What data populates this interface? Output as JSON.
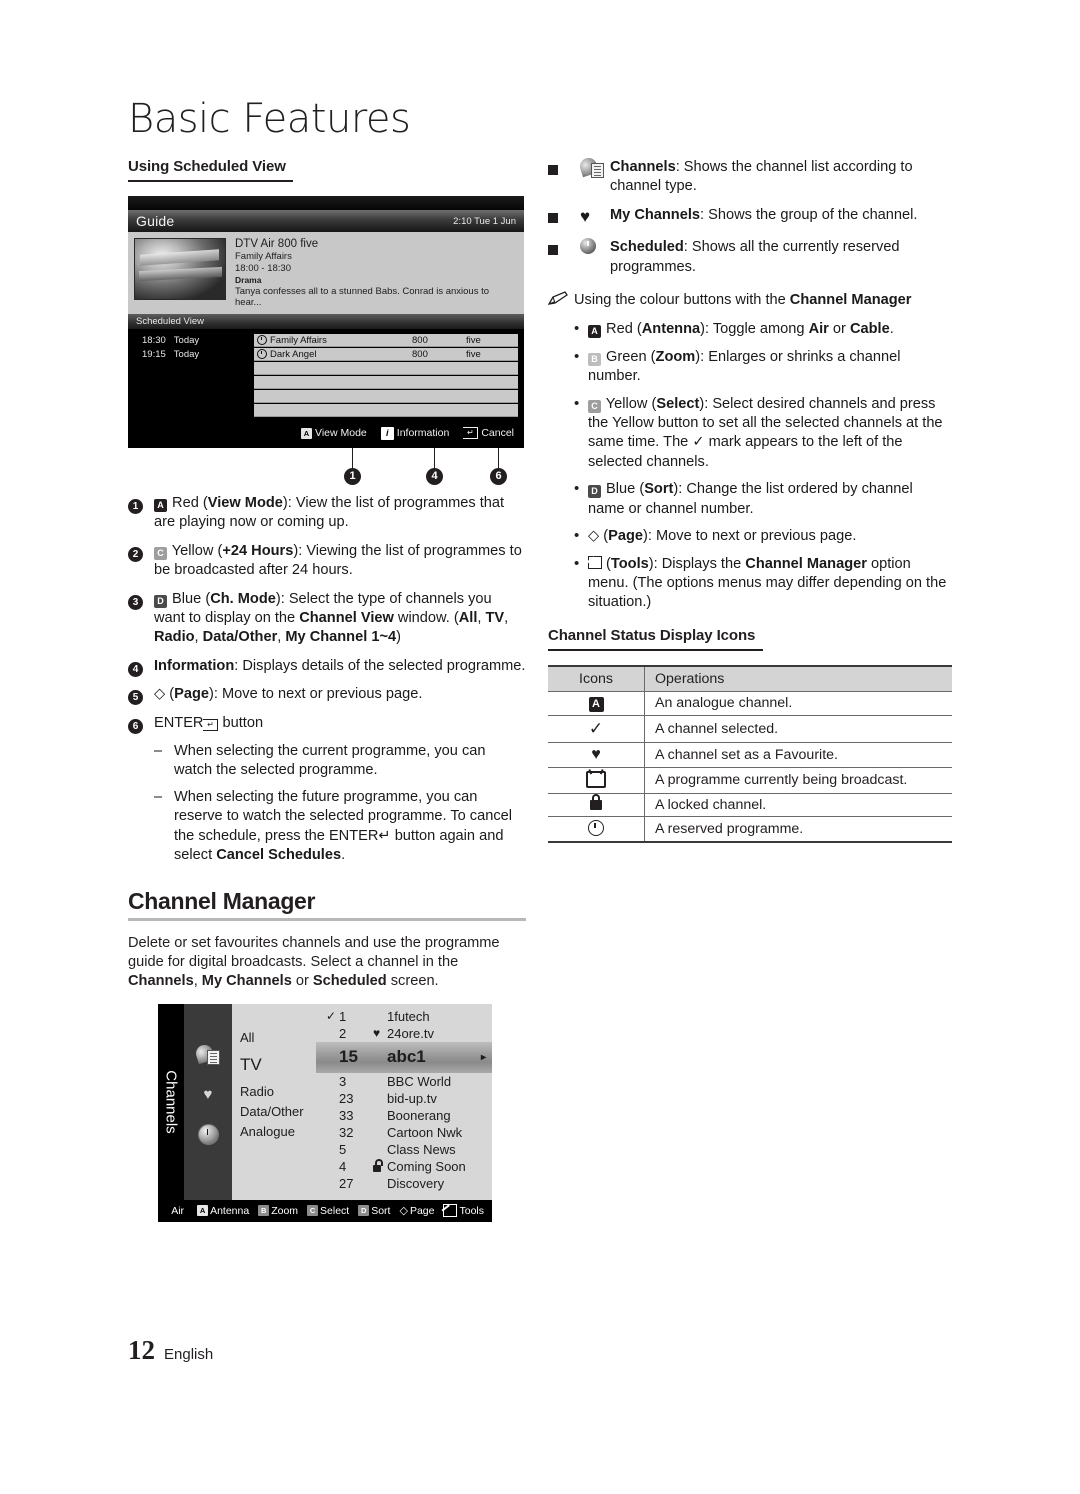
{
  "page": {
    "title": "Basic Features",
    "footer_page_number": "12",
    "footer_language": "English"
  },
  "left": {
    "subhead": "Using Scheduled View",
    "guide_screenshot": {
      "title": "Guide",
      "clock": "2:10 Tue 1 Jun",
      "info": {
        "channel": "DTV Air 800 five",
        "programme": "Family Affairs",
        "time": "18:00 - 18:30",
        "genre": "Drama",
        "description": "Tanya confesses all to a stunned Babs. Conrad is anxious to hear..."
      },
      "section_label": "Scheduled View",
      "rows": [
        {
          "time": "18:30",
          "day": "Today",
          "name": "Family Affairs",
          "number": "800",
          "network": "five"
        },
        {
          "time": "19:15",
          "day": "Today",
          "name": "Dark Angel",
          "number": "800",
          "network": "five"
        }
      ],
      "footer_buttons": [
        {
          "icon": "red-a-button-icon",
          "label": "View Mode"
        },
        {
          "icon": "information-icon",
          "label": "Information"
        },
        {
          "icon": "enter-return-icon",
          "label": "Cancel"
        }
      ],
      "callouts": [
        "1",
        "4",
        "6"
      ]
    },
    "numbered_items": [
      {
        "n": "1",
        "html": "<span class=\"ibtn red\">A</span> Red (<b>View Mode</b>): View the list of programmes that are playing now or coming up."
      },
      {
        "n": "2",
        "html": "<span class=\"ibtn yellow\">C</span> Yellow (<b>+24 Hours</b>): Viewing the list of programmes to be broadcasted after 24 hours."
      },
      {
        "n": "3",
        "html": "<span class=\"ibtn blue\">D</span> Blue (<b>Ch. Mode</b>): Select the type of channels you want to display on the <b>Channel View</b> window. (<b>All</b>, <b>TV</b>, <b>Radio</b>, <b>Data/Other</b>, <b>My Channel 1~4</b>)"
      },
      {
        "n": "4",
        "html": "<b>Information</b>: Displays details of the selected programme."
      },
      {
        "n": "5",
        "html": "&#9671; (<b>Page</b>): Move to next or previous page."
      },
      {
        "n": "6",
        "html": "ENTER<span class=\"enter-k\"></span> button"
      }
    ],
    "sub_dashes": [
      "When selecting the current programme, you can watch the selected programme.",
      "When selecting the future programme, you can reserve to watch the selected programme. To cancel the schedule, press the ENTER&#8629; button again and select <b>Cancel Schedules</b>."
    ],
    "channel_manager": {
      "heading": "Channel Manager",
      "body_html": "Delete or set favourites channels and use the programme guide for digital broadcasts. Select a channel in the <b>Channels</b>, <b>My Channels</b> or <b>Scheduled</b> screen."
    },
    "channels_screenshot": {
      "tab_label": "Channels",
      "sidebar_icons": [
        "channels-icon",
        "my-channels-heart-icon",
        "scheduled-clock-icon"
      ],
      "categories": [
        "All",
        "TV",
        "Radio",
        "Data/Other",
        "Analogue"
      ],
      "selected_category": "TV",
      "channel_rows": [
        {
          "mark": "✓",
          "number": "1",
          "fav": "",
          "name": "1futech"
        },
        {
          "mark": "",
          "number": "2",
          "fav": "♥",
          "name": "24ore.tv"
        },
        {
          "mark": "",
          "number": "15",
          "fav": "",
          "name": "abc1",
          "selected": true
        },
        {
          "mark": "",
          "number": "3",
          "fav": "",
          "name": "BBC World"
        },
        {
          "mark": "",
          "number": "23",
          "fav": "",
          "name": "bid-up.tv"
        },
        {
          "mark": "",
          "number": "33",
          "fav": "",
          "name": "Boonerang"
        },
        {
          "mark": "",
          "number": "32",
          "fav": "",
          "name": "Cartoon Nwk"
        },
        {
          "mark": "",
          "number": "5",
          "fav": "",
          "name": "Class News"
        },
        {
          "mark": "",
          "number": "4",
          "fav": "lock",
          "name": "Coming Soon"
        },
        {
          "mark": "",
          "number": "27",
          "fav": "",
          "name": "Discovery"
        }
      ],
      "footer": {
        "mode": "Air",
        "buttons": [
          {
            "key": "A",
            "label": "Antenna"
          },
          {
            "key": "B",
            "label": "Zoom"
          },
          {
            "key": "C",
            "label": "Select"
          },
          {
            "key": "D",
            "label": "Sort"
          },
          {
            "key": "page",
            "label": "Page"
          },
          {
            "key": "tools",
            "label": "Tools"
          }
        ]
      }
    }
  },
  "right": {
    "square_items": [
      {
        "icon": "channels-icon",
        "html": "<b>Channels</b>: Shows the channel list according to channel type."
      },
      {
        "icon": "heart-icon",
        "html": "<b>My Channels</b>: Shows the group of the channel."
      },
      {
        "icon": "clock-icon",
        "html": "<b>Scheduled</b>: Shows all the currently reserved programmes."
      }
    ],
    "note_html": "Using the colour buttons with the <b>Channel Manager</b>",
    "dot_items": [
      "<span class=\"ibtn red\">A</span> Red (<b>Antenna</b>): Toggle among <b>Air</b> or <b>Cable</b>.",
      "<span class=\"ibtn green\">B</span> Green (<b>Zoom</b>): Enlarges or shrinks a channel number.",
      "<span class=\"ibtn yellow\">C</span> Yellow (<b>Select</b>): Select desired channels and press the Yellow button to set all the selected channels at the same time. The ✓ mark appears to the left of the selected channels.",
      "<span class=\"ibtn blue\">D</span> Blue (<b>Sort</b>): Change the list ordered by channel name or channel number.",
      "&#9671; (<b>Page</b>): Move to next or previous page.",
      "<span class=\"tools-inline\"></span> (<b>Tools</b>): Displays the <b>Channel Manager</b> option menu. (The options menus may differ depending on the situation.)"
    ],
    "table": {
      "subhead": "Channel Status Display Icons",
      "headers": [
        "Icons",
        "Operations"
      ],
      "rows": [
        {
          "icon": "analogue-a-icon",
          "operation": "An analogue channel."
        },
        {
          "icon": "check-icon",
          "operation": "A channel selected."
        },
        {
          "icon": "heart-icon",
          "operation": "A channel set as a Favourite."
        },
        {
          "icon": "tv-icon",
          "operation": "A programme currently being broadcast."
        },
        {
          "icon": "lock-icon",
          "operation": "A locked channel."
        },
        {
          "icon": "clock-icon",
          "operation": "A reserved programme."
        }
      ]
    }
  }
}
